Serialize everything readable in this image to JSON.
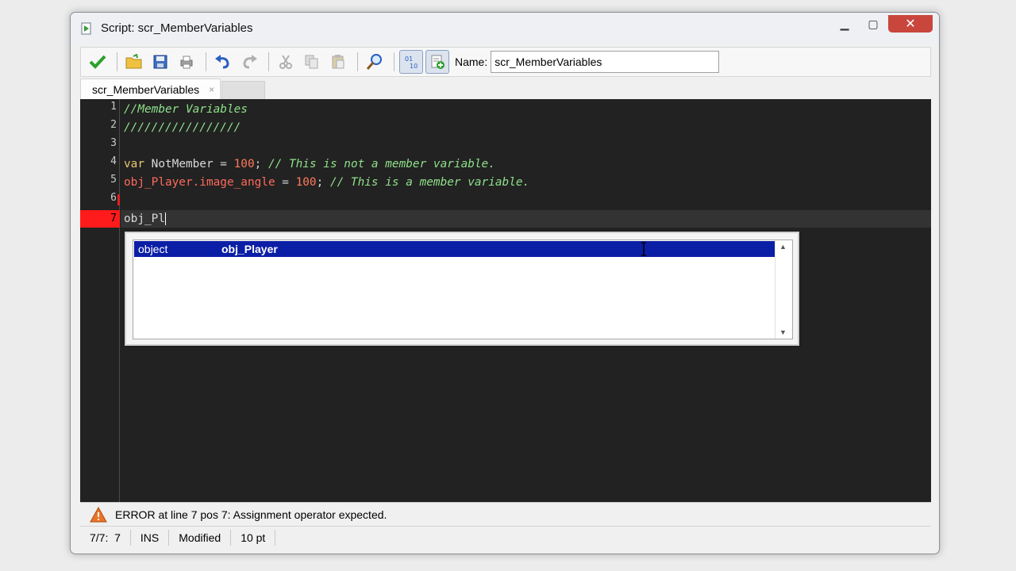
{
  "window": {
    "title": "Script: scr_MemberVariables"
  },
  "toolbar": {
    "name_label": "Name:",
    "name_value": "scr_MemberVariables",
    "buttons": [
      "ok-check-icon",
      "open-folder-icon",
      "save-disk-icon",
      "print-icon",
      "undo-icon",
      "redo-icon",
      "cut-icon",
      "copy-icon",
      "paste-icon",
      "find-icon",
      "syntax-check-icon",
      "insert-resource-icon"
    ]
  },
  "tabs": [
    {
      "label": "scr_MemberVariables",
      "close": "×"
    }
  ],
  "editor": {
    "line_numbers": [
      "1",
      "2",
      "3",
      "4",
      "5",
      "6",
      "7"
    ],
    "lines": [
      {
        "comment": "//Member Variables"
      },
      {
        "comment": "/////////////////"
      },
      {},
      {
        "kw": "var",
        "ident": " NotMember = ",
        "num": "100",
        "tail": ";",
        "comment": " // This is not a member variable."
      },
      {
        "obj": "obj_Player.image_angle",
        "ident": " = ",
        "num": "100",
        "tail": ";",
        "comment": " // This is a member variable."
      },
      {},
      {
        "ident": "obj_Pl"
      }
    ],
    "colors": {
      "background": "#222222",
      "comment": "#8fe08a",
      "keyword": "#e8c872",
      "number": "#ff7a5a",
      "object": "#ff6a5c",
      "error_line": "#ff1b1b"
    }
  },
  "autocomplete": {
    "items": [
      {
        "type": "object",
        "label": "obj_Player"
      }
    ],
    "selected_color": "#0b1ea6"
  },
  "error": {
    "message": "ERROR at line 7 pos 7: Assignment operator expected."
  },
  "status": {
    "position": "7/7:  7",
    "mode": "INS",
    "state": "Modified",
    "font_size": "10 pt"
  }
}
